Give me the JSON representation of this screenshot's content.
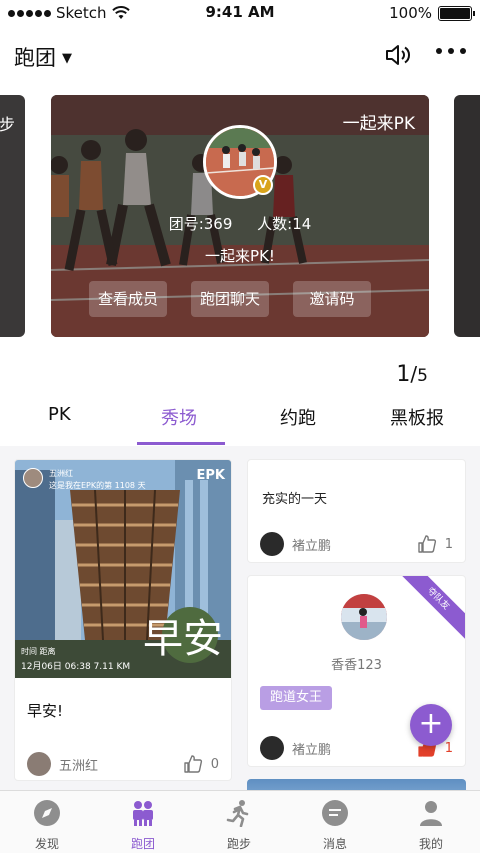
{
  "status_bar": {
    "carrier": "Sketch",
    "time": "9:41 AM",
    "battery": "100%"
  },
  "header": {
    "title": "跑团"
  },
  "carousel": {
    "left_peek_text": "步",
    "card": {
      "title": "一起来PK",
      "team_id": "团号:369",
      "members": "人数:14",
      "slogan": "一起来PK!",
      "avatar_badge": "V",
      "buttons": [
        "查看成员",
        "跑团聊天",
        "邀请码"
      ]
    },
    "pager": {
      "current": "1",
      "total": "5"
    }
  },
  "tabs": [
    {
      "label": "PK",
      "active": false
    },
    {
      "label": "秀场",
      "active": true
    },
    {
      "label": "约跑",
      "active": false
    },
    {
      "label": "黑板报",
      "active": false
    }
  ],
  "feed": {
    "post1": {
      "photo_user": "五洲红",
      "photo_line2": "这是我在EPK的第 1108 天",
      "photo_logo": "EPK",
      "photo_meta_labels": "时间          距离",
      "photo_meta_values": "12月06日 06:38    7.11 KM",
      "photo_big_text": "早安",
      "caption": "早安!",
      "author": "五洲红",
      "likes": "0"
    },
    "post2": {
      "text": "充实的一天",
      "author": "褚立鹏",
      "likes": "1"
    },
    "post3": {
      "ribbon": "夺队友",
      "username": "香香123",
      "tag": "跑道女王",
      "author": "褚立鹏",
      "likes": "1"
    }
  },
  "fab": {
    "label": "+"
  },
  "bottom_nav": [
    {
      "label": "发现",
      "icon": "compass-icon",
      "active": false
    },
    {
      "label": "跑团",
      "icon": "group-icon",
      "active": true
    },
    {
      "label": "跑步",
      "icon": "runner-icon",
      "active": false
    },
    {
      "label": "消息",
      "icon": "message-icon",
      "active": false
    },
    {
      "label": "我的",
      "icon": "profile-icon",
      "active": false
    }
  ],
  "colors": {
    "accent": "#8c5bd0",
    "tag_bg": "#b99ee4",
    "like_active": "#e2402a"
  }
}
